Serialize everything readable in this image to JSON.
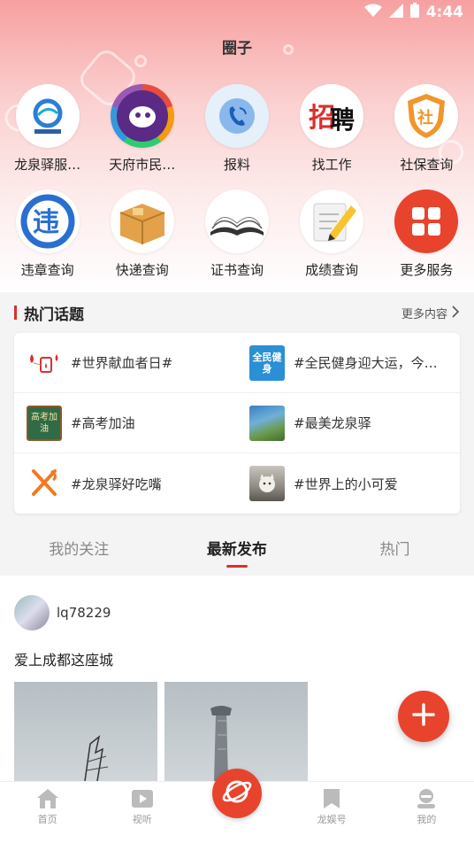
{
  "status_bar": {
    "time": "4:44"
  },
  "title": "圈子",
  "services_row1": [
    {
      "label": "龙泉驿服…",
      "icon": "longquan-logo-icon"
    },
    {
      "label": "天府市民…",
      "icon": "tianfu-citizen-icon"
    },
    {
      "label": "报料",
      "icon": "phone-icon"
    },
    {
      "label": "找工作",
      "icon": "recruit-icon"
    },
    {
      "label": "社保查询",
      "icon": "social-security-icon"
    }
  ],
  "services_row2": [
    {
      "label": "违章查询",
      "icon": "traffic-violation-icon"
    },
    {
      "label": "快递查询",
      "icon": "package-icon"
    },
    {
      "label": "证书查询",
      "icon": "book-icon"
    },
    {
      "label": "成绩查询",
      "icon": "notepad-pencil-icon"
    },
    {
      "label": "更多服务",
      "icon": "grid-icon"
    }
  ],
  "topics_section": {
    "title": "热门话题",
    "more": "更多内容"
  },
  "topics": [
    {
      "text": "#世界献血者日#",
      "icon": "blood-donation-icon"
    },
    {
      "text": "#全民健身迎大运，今…",
      "icon": "fitness-badge-icon",
      "badge": "全民健身"
    },
    {
      "text": "#高考加油",
      "icon": "exam-chalkboard-icon",
      "badge": "高考加油"
    },
    {
      "text": "#最美龙泉驿",
      "icon": "landscape-photo-icon"
    },
    {
      "text": "#龙泉驿好吃嘴",
      "icon": "fork-knife-icon"
    },
    {
      "text": "#世界上的小可爱",
      "icon": "cute-cat-photo-icon"
    }
  ],
  "tabs": [
    "我的关注",
    "最新发布",
    "热门"
  ],
  "post": {
    "username": "lq78229",
    "text": "爱上成都这座城"
  },
  "bottom_nav": [
    {
      "label": "首页",
      "icon": "home-icon"
    },
    {
      "label": "视听",
      "icon": "play-icon"
    },
    {
      "label": "",
      "icon": "planet-icon"
    },
    {
      "label": "龙娱号",
      "icon": "bookmark-icon"
    },
    {
      "label": "我的",
      "icon": "profile-icon"
    }
  ],
  "colors": {
    "accent": "#e8432d",
    "topic_bar": "#d9302c"
  }
}
